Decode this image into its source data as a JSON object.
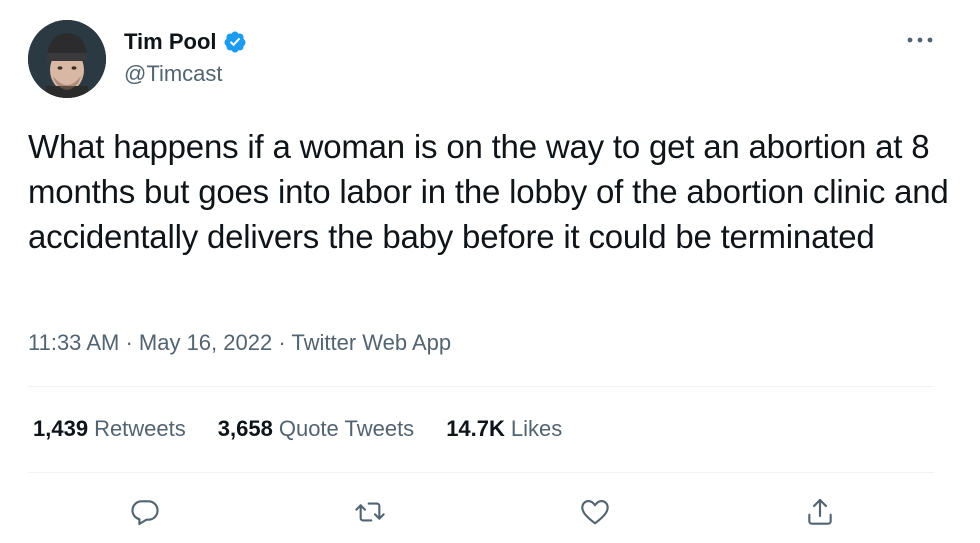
{
  "author": {
    "display_name": "Tim Pool",
    "handle": "@Timcast",
    "verified": true
  },
  "tweet": {
    "text": "What happens if a woman is on the way to get an abortion at 8 months but goes into labor in the lobby of the abortion clinic and accidentally delivers the baby before it could be terminated",
    "time": "11:33 AM",
    "date": "May 16, 2022",
    "source": "Twitter Web App"
  },
  "stats": {
    "retweets": {
      "count": "1,439",
      "label": "Retweets"
    },
    "quote_tweets": {
      "count": "3,658",
      "label": "Quote Tweets"
    },
    "likes": {
      "count": "14.7K",
      "label": "Likes"
    }
  },
  "icons": {
    "more": "more-horizontal-icon",
    "verified": "verified-badge-icon",
    "reply": "reply-icon",
    "retweet": "retweet-icon",
    "like": "heart-icon",
    "share": "share-icon"
  },
  "colors": {
    "text_primary": "#0f1419",
    "text_secondary": "#536471",
    "verified_blue": "#1d9bf0",
    "divider": "#eff3f4"
  }
}
